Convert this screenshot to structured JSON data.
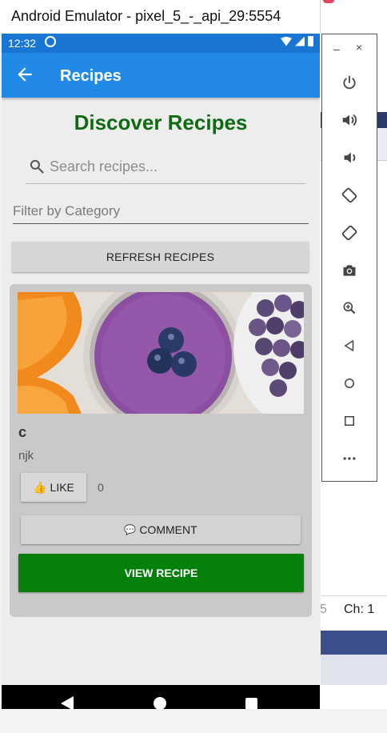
{
  "window": {
    "title": "Android Emulator - pixel_5_-_api_29:5554"
  },
  "status_bar": {
    "time": "12:32"
  },
  "app_bar": {
    "title": "Recipes"
  },
  "page": {
    "heading": "Discover Recipes",
    "search_placeholder": "Search recipes...",
    "filter_label": "Filter by Category",
    "refresh_label": "REFRESH RECIPES"
  },
  "recipe_card": {
    "name": "c",
    "description": "njk",
    "like_label": "LIKE",
    "like_icon": "👍",
    "like_count": "0",
    "comment_label": "COMMENT",
    "comment_icon": "💬",
    "view_label": "VIEW RECIPE"
  },
  "side_toolbar": {
    "minimize": "–",
    "close": "×",
    "tools": [
      "power-icon",
      "volume-up-icon",
      "volume-down-icon",
      "rotate-left-icon",
      "rotate-right-icon",
      "camera-icon",
      "zoom-icon",
      "back-icon",
      "home-icon",
      "overview-icon",
      "more-icon"
    ]
  },
  "background": {
    "status_text": "Ch: 1",
    "partial_text": "5"
  },
  "colors": {
    "app_bar": "#2189e6",
    "status_bar": "#1976d2",
    "heading": "#0f6b12",
    "view_button": "#05800a"
  }
}
